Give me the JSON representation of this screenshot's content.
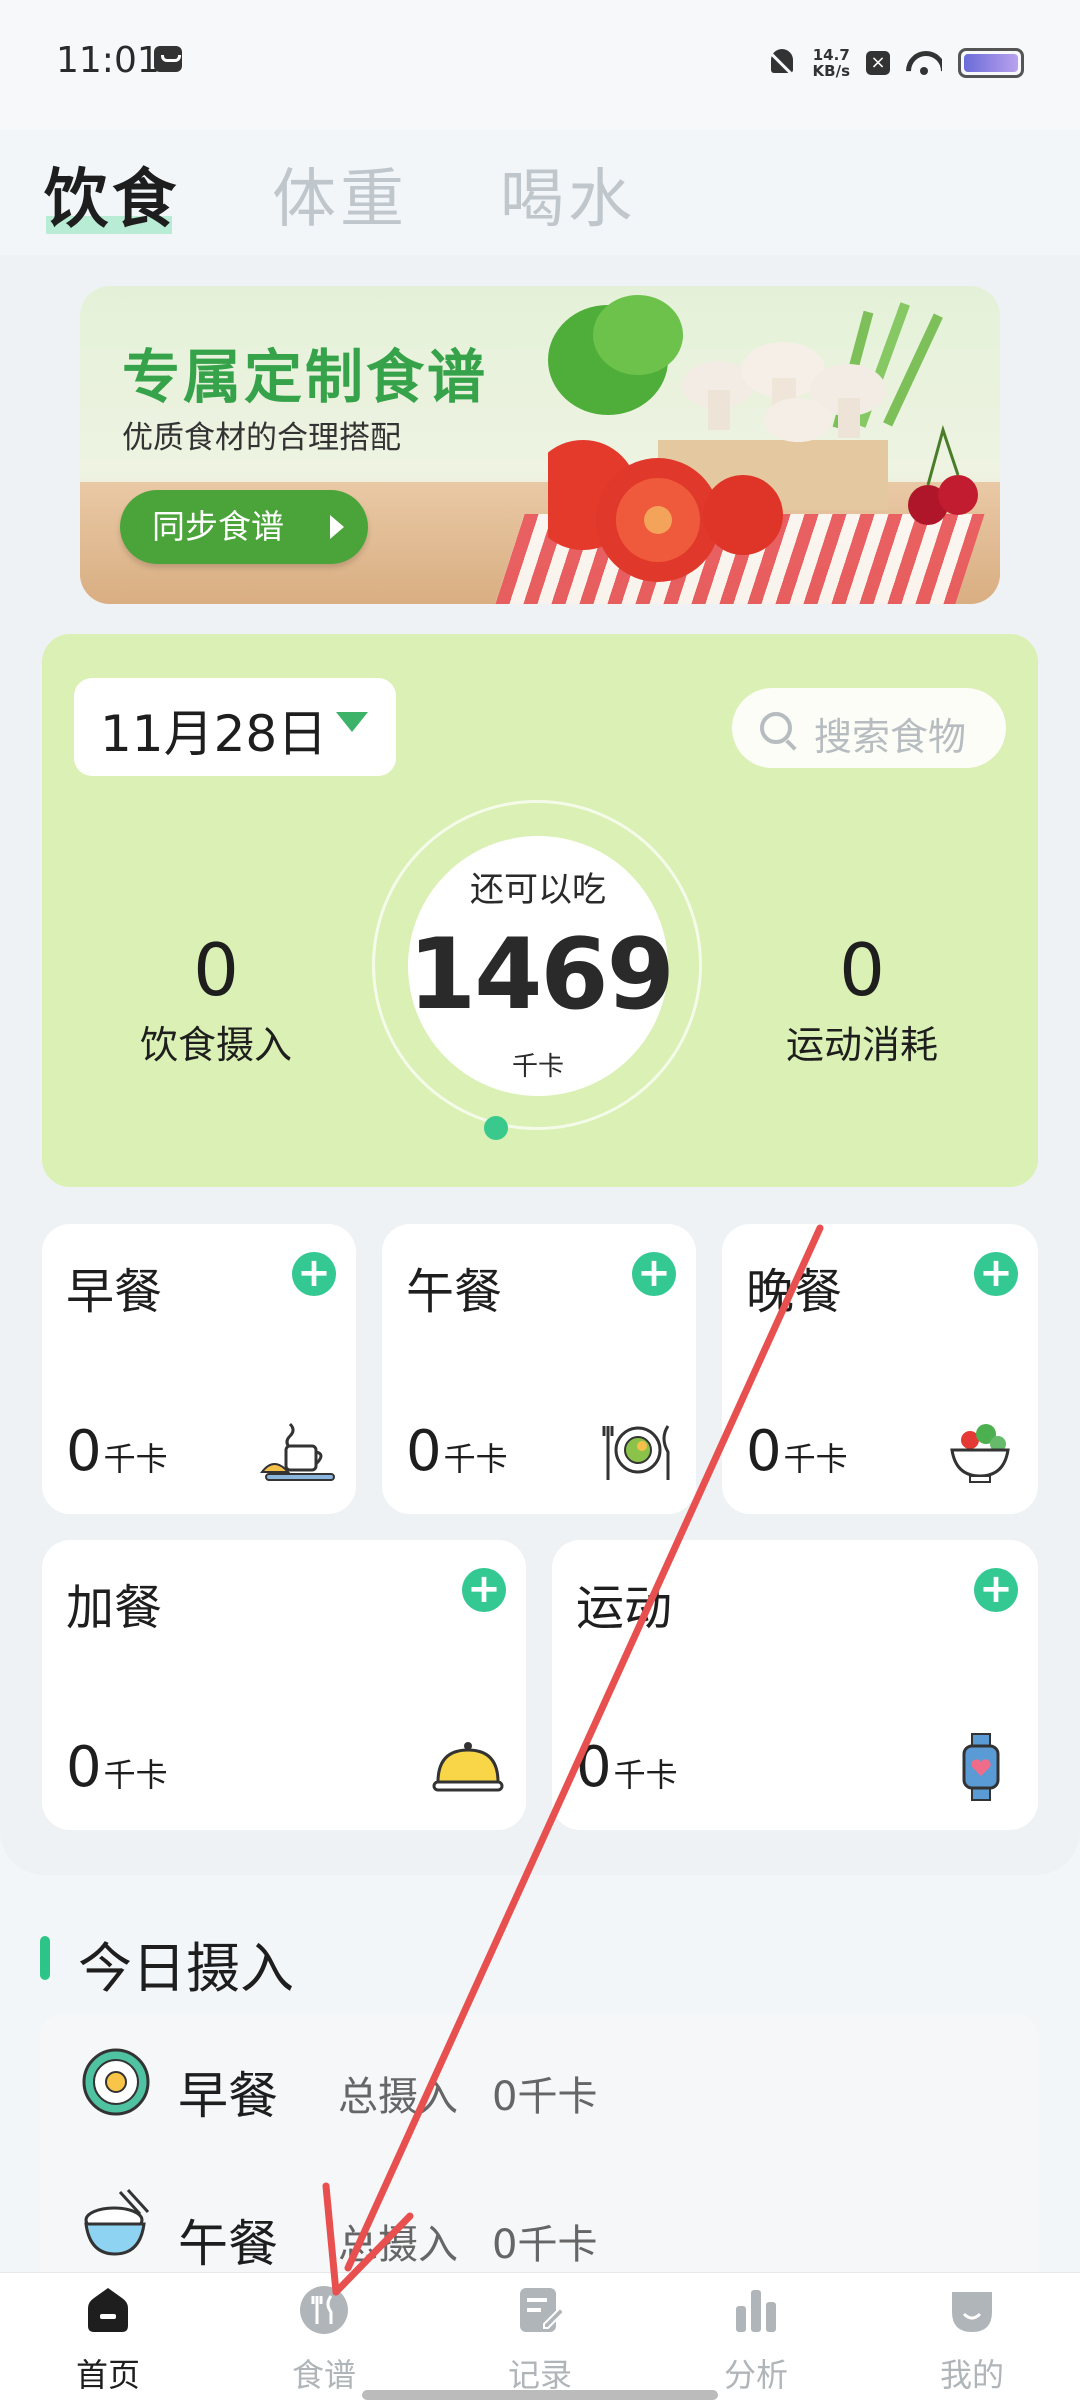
{
  "status_bar": {
    "time": "11:01",
    "speed_value": "14.7",
    "speed_unit": "KB/s"
  },
  "top_tabs": [
    {
      "label": "饮食",
      "active": true
    },
    {
      "label": "体重",
      "active": false
    },
    {
      "label": "喝水",
      "active": false
    }
  ],
  "banner": {
    "title": "专属定制食谱",
    "subtitle": "优质食材的合理搭配",
    "button_label": "同步食谱"
  },
  "calories": {
    "date": "11月28日",
    "search_placeholder": "搜索食物",
    "remaining_label": "还可以吃",
    "remaining_value": "1469",
    "remaining_unit": "千卡",
    "intake_value": "0",
    "intake_label": "饮食摄入",
    "burn_value": "0",
    "burn_label": "运动消耗"
  },
  "meals": [
    {
      "title": "早餐",
      "value": "0",
      "unit": "千卡",
      "icon": "coffee-croissant-icon"
    },
    {
      "title": "午餐",
      "value": "0",
      "unit": "千卡",
      "icon": "plate-fork-knife-icon"
    },
    {
      "title": "晚餐",
      "value": "0",
      "unit": "千卡",
      "icon": "salad-bowl-icon"
    },
    {
      "title": "加餐",
      "value": "0",
      "unit": "千卡",
      "icon": "cloche-icon"
    },
    {
      "title": "运动",
      "value": "0",
      "unit": "千卡",
      "icon": "smartwatch-icon"
    }
  ],
  "today": {
    "title": "今日摄入",
    "rows": [
      {
        "name": "早餐",
        "total_label": "总摄入",
        "value": "0千卡",
        "icon": "fried-egg-icon"
      },
      {
        "name": "午餐",
        "total_label": "总摄入",
        "value": "0千卡",
        "icon": "rice-bowl-icon"
      }
    ]
  },
  "bottom_nav": [
    {
      "label": "首页",
      "icon": "home-icon",
      "active": true
    },
    {
      "label": "食谱",
      "icon": "utensils-icon",
      "active": false
    },
    {
      "label": "记录",
      "icon": "record-edit-icon",
      "active": false
    },
    {
      "label": "分析",
      "icon": "bar-chart-icon",
      "active": false
    },
    {
      "label": "我的",
      "icon": "profile-icon",
      "active": false
    }
  ],
  "colors": {
    "accent": "#34c893",
    "panel": "#daf0b4",
    "banner_green": "#36a24a",
    "annotation_arrow": "#e8504f"
  }
}
